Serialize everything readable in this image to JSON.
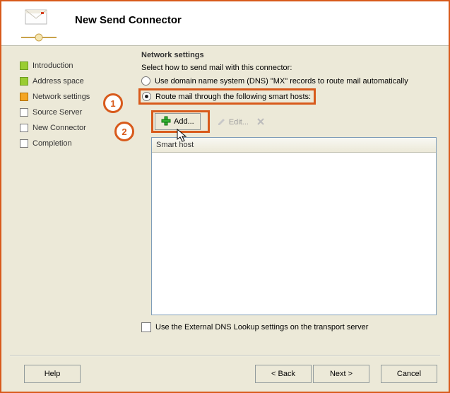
{
  "header": {
    "title": "New Send Connector"
  },
  "sidebar": {
    "steps": [
      {
        "label": "Introduction",
        "state": "done"
      },
      {
        "label": "Address space",
        "state": "done"
      },
      {
        "label": "Network settings",
        "state": "current"
      },
      {
        "label": "Source Server",
        "state": "pending"
      },
      {
        "label": "New Connector",
        "state": "pending"
      },
      {
        "label": "Completion",
        "state": "pending"
      }
    ]
  },
  "content": {
    "group_title": "Network settings",
    "prompt": "Select how to send mail with this connector:",
    "radio_dns": "Use domain name system (DNS) \"MX\" records to route mail automatically",
    "radio_smart": "Route mail through the following smart hosts:",
    "toolbar": {
      "add": "Add...",
      "edit": "Edit...",
      "remove_title": "Remove"
    },
    "list": {
      "column": "Smart host"
    },
    "checkbox_ext_dns": "Use the External DNS Lookup settings on the transport server"
  },
  "footer": {
    "help": "Help",
    "back": "< Back",
    "next": "Next >",
    "cancel": "Cancel"
  },
  "annotations": {
    "one": "1",
    "two": "2"
  }
}
